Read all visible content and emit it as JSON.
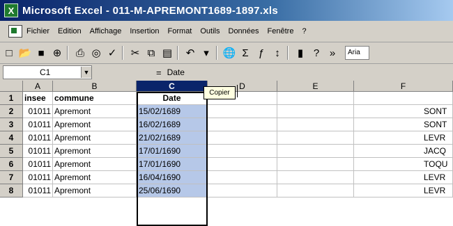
{
  "title_bar": {
    "app_icon": "excel-icon",
    "title": "Microsoft Excel - 011-M-APREMONT1689-1897.xls"
  },
  "menu_bar": {
    "items": [
      "Fichier",
      "Edition",
      "Affichage",
      "Insertion",
      "Format",
      "Outils",
      "Données",
      "Fenêtre",
      "?"
    ]
  },
  "toolbar": {
    "buttons": [
      "new-icon",
      "open-icon",
      "save-icon",
      "permission-icon",
      "print-icon",
      "print-preview-icon",
      "spelling-icon",
      "cut-icon",
      "copy-icon",
      "paste-icon",
      "undo-icon",
      "hyperlink-icon",
      "autosum-icon",
      "function-icon",
      "sort-icon",
      "chart-icon",
      "help-icon",
      "more-icon"
    ],
    "font_name": "Aria"
  },
  "formula_bar": {
    "name_box": "C1",
    "equals": "=",
    "value": "Date"
  },
  "tooltip": {
    "text": "Copier"
  },
  "grid": {
    "column_headers": [
      "A",
      "B",
      "C",
      "D",
      "E",
      "F"
    ],
    "selected_column": "C",
    "row_headers": [
      "1",
      "2",
      "3",
      "4",
      "5",
      "6",
      "7",
      "8"
    ],
    "rows": [
      {
        "insee": "insee",
        "commune": "commune",
        "date": "Date",
        "far": ""
      },
      {
        "insee": "01011",
        "commune": "Apremont",
        "date": "15/02/1689",
        "far": "SONT"
      },
      {
        "insee": "01011",
        "commune": "Apremont",
        "date": "16/02/1689",
        "far": "SONT"
      },
      {
        "insee": "01011",
        "commune": "Apremont",
        "date": "21/02/1689",
        "far": "LEVR"
      },
      {
        "insee": "01011",
        "commune": "Apremont",
        "date": "17/01/1690",
        "far": "JACQ"
      },
      {
        "insee": "01011",
        "commune": "Apremont",
        "date": "17/01/1690",
        "far": "TOQU"
      },
      {
        "insee": "01011",
        "commune": "Apremont",
        "date": "16/04/1690",
        "far": "LEVR"
      },
      {
        "insee": "01011",
        "commune": "Apremont",
        "date": "25/06/1690",
        "far": "LEVR"
      }
    ]
  }
}
